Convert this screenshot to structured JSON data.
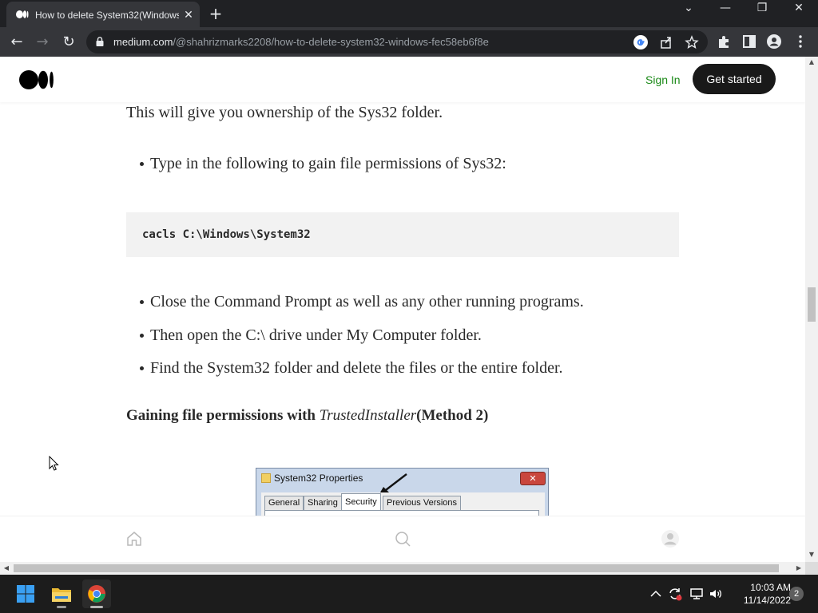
{
  "browser": {
    "tab_title": "How to delete System32(Windows",
    "tab_close": "✕",
    "new_tab": "+",
    "url_host": "medium.com",
    "url_path": "/@shahrizmarks2208/how-to-delete-system32-windows-fec58eb6f8e",
    "window_controls": {
      "tab_search": "⌄",
      "minimize": "—",
      "restore": "❐",
      "close": "✕"
    },
    "nav": {
      "back": "←",
      "forward": "→",
      "reload": "↻"
    }
  },
  "site": {
    "sign_in": "Sign In",
    "get_started": "Get started"
  },
  "article": {
    "intro": "This will give you ownership of the Sys32 folder.",
    "bullet_1": "Type in the following to gain file permissions of Sys32:",
    "code": "cacls C:\\Windows\\System32",
    "bullets": [
      "Close the Command Prompt as well as any other running programs.",
      "Then open the C:\\ drive under My Computer folder.",
      "Find the System32 folder and delete the files or the entire folder."
    ],
    "heading_prefix": "Gaining file permissions with ",
    "heading_italic": "TrustedInstaller",
    "heading_suffix": "(Method 2)"
  },
  "embedded_image": {
    "window_title": "System32 Properties",
    "close_glyph": "✕",
    "tabs": [
      "General",
      "Sharing",
      "Security",
      "Previous Versions"
    ],
    "active_tab": "Security"
  },
  "taskbar": {
    "time": "10:03 AM",
    "date": "11/14/2022",
    "notification_count": "2"
  },
  "colors": {
    "accent_green": "#1a8917",
    "button_dark": "#191919",
    "chrome_dark": "#202124",
    "chrome_toolbar": "#35363a"
  }
}
